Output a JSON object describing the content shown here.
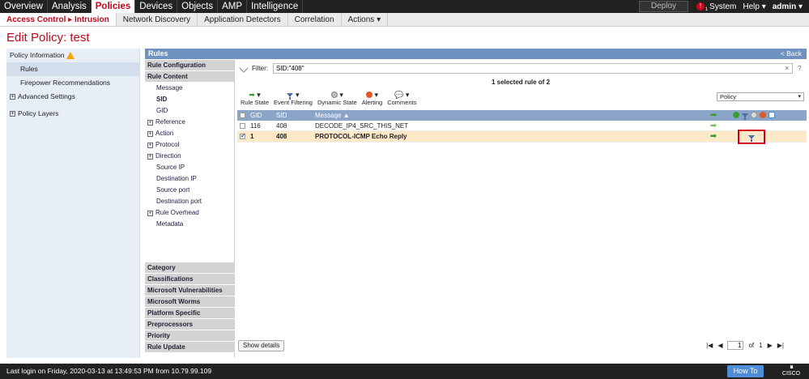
{
  "topnav": {
    "items": [
      "Overview",
      "Analysis",
      "Policies",
      "Devices",
      "Objects",
      "AMP",
      "Intelligence"
    ],
    "active_index": 2,
    "deploy_label": "Deploy",
    "alert_count": "1",
    "system_label": "System",
    "help_label": "Help ▾",
    "user_label": "admin ▾"
  },
  "subnav": {
    "active": {
      "part1": "Access Control",
      "arrow": "▸",
      "part2": "Intrusion"
    },
    "items": [
      "Network Discovery",
      "Application Detectors",
      "Correlation",
      "Actions ▾"
    ]
  },
  "page_title": "Edit Policy: test",
  "leftnav": {
    "policy_information": "Policy Information",
    "rules": "Rules",
    "firepower_recommendations": "Firepower Recommendations",
    "advanced_settings": "Advanced Settings",
    "policy_layers": "Policy Layers"
  },
  "rules_panel": {
    "title": "Rules",
    "back_label": "< Back",
    "rule_configuration": "Rule Configuration",
    "rule_content": "Rule Content",
    "content_items": [
      {
        "label": "Message",
        "expandable": false
      },
      {
        "label": "SID",
        "expandable": false,
        "bold": true
      },
      {
        "label": "GID",
        "expandable": false
      },
      {
        "label": "Reference",
        "expandable": true
      },
      {
        "label": "Action",
        "expandable": true
      },
      {
        "label": "Protocol",
        "expandable": true
      },
      {
        "label": "Direction",
        "expandable": true
      },
      {
        "label": "Source IP",
        "expandable": false
      },
      {
        "label": "Destination IP",
        "expandable": false
      },
      {
        "label": "Source port",
        "expandable": false
      },
      {
        "label": "Destination port",
        "expandable": false
      },
      {
        "label": "Rule Overhead",
        "expandable": true
      },
      {
        "label": "Metadata",
        "expandable": false
      }
    ],
    "categories": [
      "Category",
      "Classifications",
      "Microsoft Vulnerabilities",
      "Microsoft Worms",
      "Platform Specific",
      "Preprocessors",
      "Priority",
      "Rule Update"
    ]
  },
  "filter": {
    "label": "Filter:",
    "value": "SID:\"408\"",
    "clear": "×",
    "help": "?"
  },
  "selected_count": "1 selected rule of 2",
  "toolbar": {
    "rule_state": "Rule State",
    "event_filtering": "Event Filtering",
    "dynamic_state": "Dynamic State",
    "alerting": "Alerting",
    "comments": "Comments"
  },
  "policy_select": "Policy",
  "table": {
    "headers": {
      "gid": "GID",
      "sid": "SID",
      "message": "Message ▲"
    },
    "rows": [
      {
        "gid": "116",
        "sid": "408",
        "message": "DECODE_IP4_SRC_THIS_NET",
        "selected": false
      },
      {
        "gid": "1",
        "sid": "408",
        "message": "PROTOCOL-ICMP Echo Reply",
        "selected": true
      }
    ]
  },
  "bottom": {
    "show_details": "Show details",
    "page": "1",
    "of_label": "of",
    "total_pages": "1"
  },
  "footer": {
    "last_login": "Last login on Friday, 2020-03-13 at 13:49:53 PM from 10.79.99.109",
    "how_to": "How To",
    "brand": "CISCO"
  },
  "colors": {
    "accent_red": "#c0081a",
    "header_blue": "#6f93c0",
    "selected_row": "#fde8c8",
    "highlight_box": "#d0021b"
  }
}
